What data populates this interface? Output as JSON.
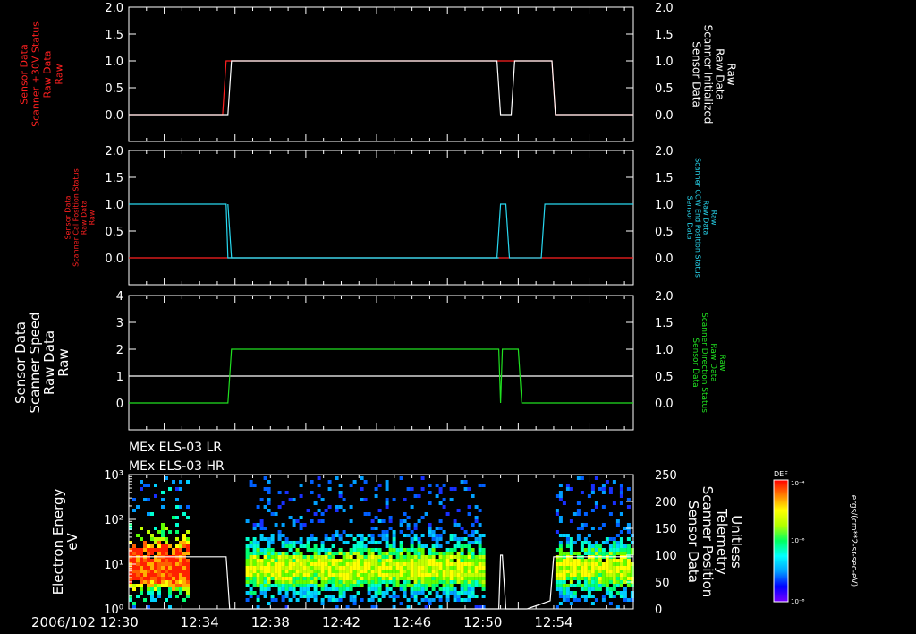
{
  "colors": {
    "white": "#ffffff",
    "red": "#ff2020",
    "cyan": "#28d8f0",
    "green": "#20e020",
    "colorbar_stops": [
      "#7800ff",
      "#0000ff",
      "#00a0ff",
      "#00ffff",
      "#00ff60",
      "#b0ff00",
      "#ffff00",
      "#ff8000",
      "#ff0000"
    ]
  },
  "instrument_labels": [
    "MEx ELS-03 LR",
    "MEx ELS-03 HR"
  ],
  "time_axis": {
    "start_label": "2006/102 12:30",
    "ticks": [
      "12:34",
      "12:38",
      "12:42",
      "12:46",
      "12:50",
      "12:54"
    ],
    "start_minutes": 0,
    "end_minutes": 28.5
  },
  "colorbar": {
    "title": "DEF",
    "unit_label": "ergs/(cm**2-sr-sec-eV)",
    "tick_labels": [
      "10⁻⁴",
      "10⁻⁶",
      "10⁻⁸"
    ]
  },
  "chart_data": [
    {
      "type": "line",
      "left_label_lines": [
        "Sensor Data",
        "Scanner +30V Status",
        "Raw Data",
        "Raw"
      ],
      "right_label_lines": [
        "Sensor Data",
        "Scanner Initialized",
        "Raw Data",
        "Raw"
      ],
      "left_axis": {
        "ticks": [
          "0.0",
          "0.5",
          "1.0",
          "1.5",
          "2.0"
        ],
        "range": [
          -0.5,
          2.0
        ]
      },
      "right_axis": {
        "ticks": [
          "0.0",
          "0.5",
          "1.0",
          "1.5",
          "2.0"
        ],
        "range": [
          -0.5,
          2.0
        ]
      },
      "series": [
        {
          "color": "#ff2020",
          "x": [
            0,
            5.3,
            5.5,
            20.8,
            21.6,
            22.2,
            22.4,
            23.9,
            24.1,
            28.5
          ],
          "y": [
            0,
            0,
            1,
            1,
            1,
            1,
            1,
            1,
            0,
            0
          ]
        },
        {
          "color": "#ffffff",
          "x": [
            0,
            5.6,
            5.8,
            20.8,
            21.0,
            21.6,
            21.8,
            23.9,
            24.1,
            28.5
          ],
          "y": [
            0,
            0,
            1,
            1,
            0,
            0,
            1,
            1,
            0,
            0
          ]
        }
      ]
    },
    {
      "type": "line",
      "left_label_lines": [
        "Sensor Data",
        "Scanner Cal Position Status",
        "Raw Data",
        "Raw"
      ],
      "right_label_lines": [
        "Sensor Data",
        "Scanner CCW End Position Status",
        "Raw Data",
        "Raw"
      ],
      "left_axis": {
        "ticks": [
          "0.0",
          "0.5",
          "1.0",
          "1.5",
          "2.0"
        ],
        "range": [
          -0.5,
          2.0
        ]
      },
      "right_axis": {
        "ticks": [
          "0.0",
          "0.5",
          "1.0",
          "1.5",
          "2.0"
        ],
        "range": [
          -0.5,
          2.0
        ]
      },
      "series": [
        {
          "color": "#ff2020",
          "x": [
            0,
            5.5,
            5.6,
            20.8,
            21.6,
            22.3,
            24.1,
            28.5
          ],
          "y": [
            0,
            0,
            0,
            0,
            0,
            0,
            0,
            0
          ]
        },
        {
          "color": "#28d8f0",
          "x": [
            0,
            5.5,
            5.6,
            5.8,
            20.8,
            21.0,
            21.3,
            21.5,
            21.8,
            22.0,
            23.3,
            23.5,
            28.5
          ],
          "y": [
            1,
            1,
            0,
            0,
            0,
            1,
            1,
            0,
            0,
            0,
            0,
            1,
            1
          ]
        },
        {
          "color": "#28d8f0",
          "x": [
            5.6,
            5.8,
            20.9
          ],
          "y": [
            1,
            0,
            0
          ]
        }
      ]
    },
    {
      "type": "line",
      "left_label_lines": [
        "Sensor Data",
        "Scanner Speed",
        "Raw Data",
        "Raw"
      ],
      "right_label_lines": [
        "Sensor Data",
        "Scanner Direction Status",
        "Raw Data",
        "Raw"
      ],
      "left_axis": {
        "ticks": [
          "0",
          "1",
          "2",
          "3",
          "4"
        ],
        "range": [
          -1,
          4
        ]
      },
      "right_axis": {
        "ticks": [
          "0.0",
          "0.5",
          "1.0",
          "1.5",
          "2.0"
        ],
        "range": [
          -0.5,
          2.0
        ]
      },
      "series": [
        {
          "color": "#ffffff",
          "axis": "left",
          "x": [
            0,
            28.5
          ],
          "y": [
            1,
            1
          ]
        },
        {
          "color": "#20e020",
          "axis": "left",
          "x": [
            0,
            5.6,
            5.8,
            20.9,
            21.0,
            21.1,
            21.3,
            22.0,
            22.2,
            28.5
          ],
          "y": [
            0,
            0,
            2,
            2,
            0,
            2,
            2,
            2,
            0,
            0
          ]
        }
      ]
    },
    {
      "type": "heatmap",
      "left_label_lines": [
        "Electron Energy",
        "eV"
      ],
      "right_label_lines": [
        "Sensor Data",
        "Scanner Position",
        "Telemetry",
        "Unitless"
      ],
      "left_axis": {
        "ticks": [
          "10⁰",
          "10¹",
          "10²",
          "10³"
        ],
        "range_log10": [
          0,
          3
        ]
      },
      "right_axis": {
        "ticks": [
          "0",
          "50",
          "100",
          "150",
          "200",
          "250"
        ],
        "range": [
          0,
          250
        ]
      },
      "data_intervals_minutes": [
        [
          0,
          3.3
        ],
        [
          6.6,
          20.1
        ],
        [
          24.1,
          28.5
        ]
      ],
      "scanner_position": {
        "x": [
          0,
          5.5,
          5.7,
          20.9,
          21.0,
          21.1,
          21.3,
          22.5,
          23.8,
          24.0,
          28.5
        ],
        "y": [
          97,
          97,
          0,
          0,
          100,
          100,
          0,
          0,
          15,
          97,
          97
        ]
      }
    }
  ]
}
